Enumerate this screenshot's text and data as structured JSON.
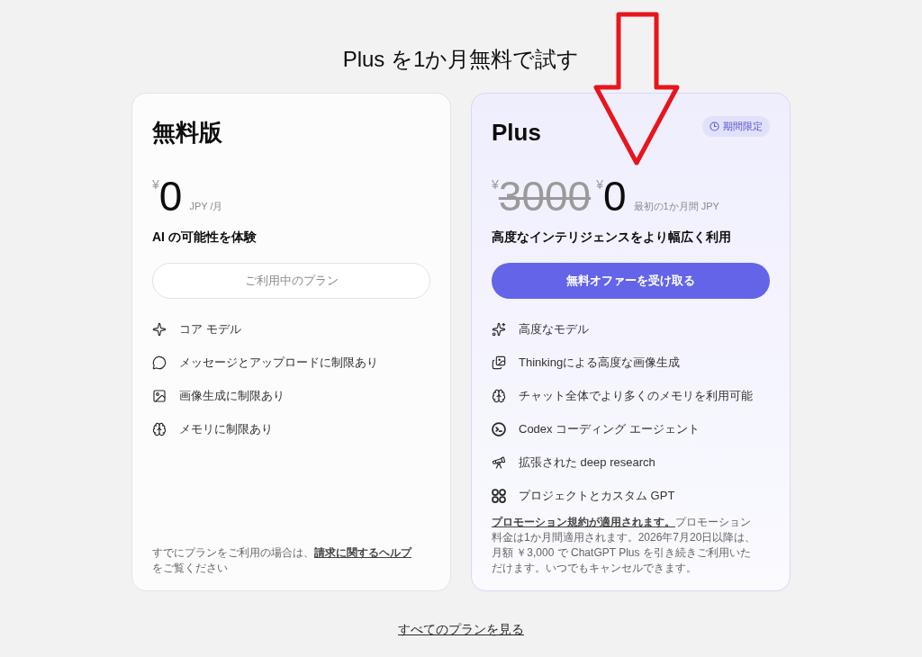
{
  "heading": "Plus を1か月無料で試す",
  "plans": [
    {
      "name": "無料版",
      "featured": false,
      "price": {
        "currency": "¥",
        "amount": "0",
        "unit": "JPY /月"
      },
      "tagline": "AI の可能性を体験",
      "button": {
        "label": "ご利用中のプラン",
        "primary": false
      },
      "features": [
        "コア モデル",
        "メッセージとアップロードに制限あり",
        "画像生成に制限あり",
        "メモリに制限あり"
      ],
      "footnote": {
        "text_before": "すでにプランをご利用の場合は、",
        "link": "請求に関するヘルプ",
        "text_after": "をご覧ください"
      }
    },
    {
      "name": "Plus",
      "featured": true,
      "badge": "期間限定",
      "original_price": {
        "currency": "¥",
        "amount": "3000"
      },
      "price": {
        "currency": "¥",
        "amount": "0",
        "unit": "最初の1か月間 JPY"
      },
      "tagline": "高度なインテリジェンスをより幅広く利用",
      "button": {
        "label": "無料オファーを受け取る",
        "primary": true
      },
      "features": [
        "高度なモデル",
        "Thinkingによる高度な画像生成",
        "チャット全体でより多くのメモリを利用可能",
        "Codex コーディング エージェント",
        "拡張された deep research",
        "プロジェクトとカスタム GPT"
      ],
      "footnote": {
        "link": "プロモーション規約が適用されます。",
        "text_after": "プロモーション料金は1か月間適用されます。2026年7月20日以降は、月額 ￥3,000 で ChatGPT Plus を引き続きご利用いただけます。いつでもキャンセルできます。"
      }
    }
  ],
  "all_plans_link": "すべてのプランを見る"
}
